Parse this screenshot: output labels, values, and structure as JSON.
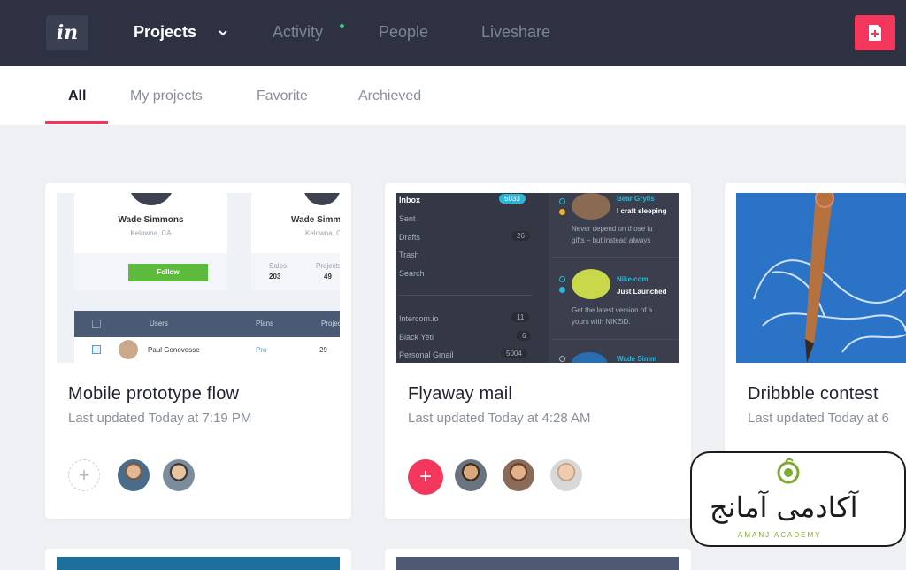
{
  "nav": {
    "logo": "in",
    "items": [
      {
        "label": "Projects"
      },
      {
        "label": "Activity"
      },
      {
        "label": "People"
      },
      {
        "label": "Liveshare"
      }
    ]
  },
  "tabs": [
    {
      "label": "All"
    },
    {
      "label": "My projects"
    },
    {
      "label": "Favorite"
    },
    {
      "label": "Archieved"
    }
  ],
  "cards": [
    {
      "title": "Mobile prototype flow",
      "updated": "Last updated Today at 7:19 PM",
      "thumb": {
        "profile_name": "Wade Simmons",
        "profile_location": "Kelowna, CA",
        "profile2_name": "Wade Simm",
        "profile2_location": "Kelowna, C",
        "follow": "Follow",
        "sales_label": "Sales",
        "sales_value": "203",
        "projects_label": "Projects",
        "projects_value": "49",
        "col_users": "Users",
        "col_plans": "Plans",
        "col_projects": "Projec",
        "row_name": "Paul Genovesse",
        "row_plan": "Pro",
        "row_count": "29"
      }
    },
    {
      "title": "Flyaway mail",
      "updated": "Last updated Today at 4:28 AM",
      "thumb": {
        "folders": [
          {
            "label": "Inbox",
            "count": "5033"
          },
          {
            "label": "Sent",
            "count": ""
          },
          {
            "label": "Drafts",
            "count": "26"
          },
          {
            "label": "Trash",
            "count": ""
          },
          {
            "label": "Search",
            "count": ""
          },
          {
            "label": "Intercom.io",
            "count": "11"
          },
          {
            "label": "Black Yeti",
            "count": "6"
          },
          {
            "label": "Personal Gmail",
            "count": "5004"
          }
        ],
        "msg1_from": "Bear Grylls",
        "msg1_subject": "I craft sleeping",
        "msg1_body1": "Never depend on those lu",
        "msg1_body2": "gifts – but instead always",
        "msg2_from": "Nike.com",
        "msg2_subject": "Just Launched",
        "msg2_body1": "Get the latest version of a",
        "msg2_body2": "yours with NIKEiD.",
        "msg3_from": "Wade Simm"
      }
    },
    {
      "title": "Dribbble contest",
      "updated": "Last updated Today at 6"
    }
  ],
  "watermark": {
    "text": "آکادمی آمانج",
    "sub": "AMANJ ACADEMY"
  },
  "colors": {
    "nav_bg": "#2d3142",
    "accent": "#f2365c",
    "activity_dot": "#3ecf8e"
  }
}
